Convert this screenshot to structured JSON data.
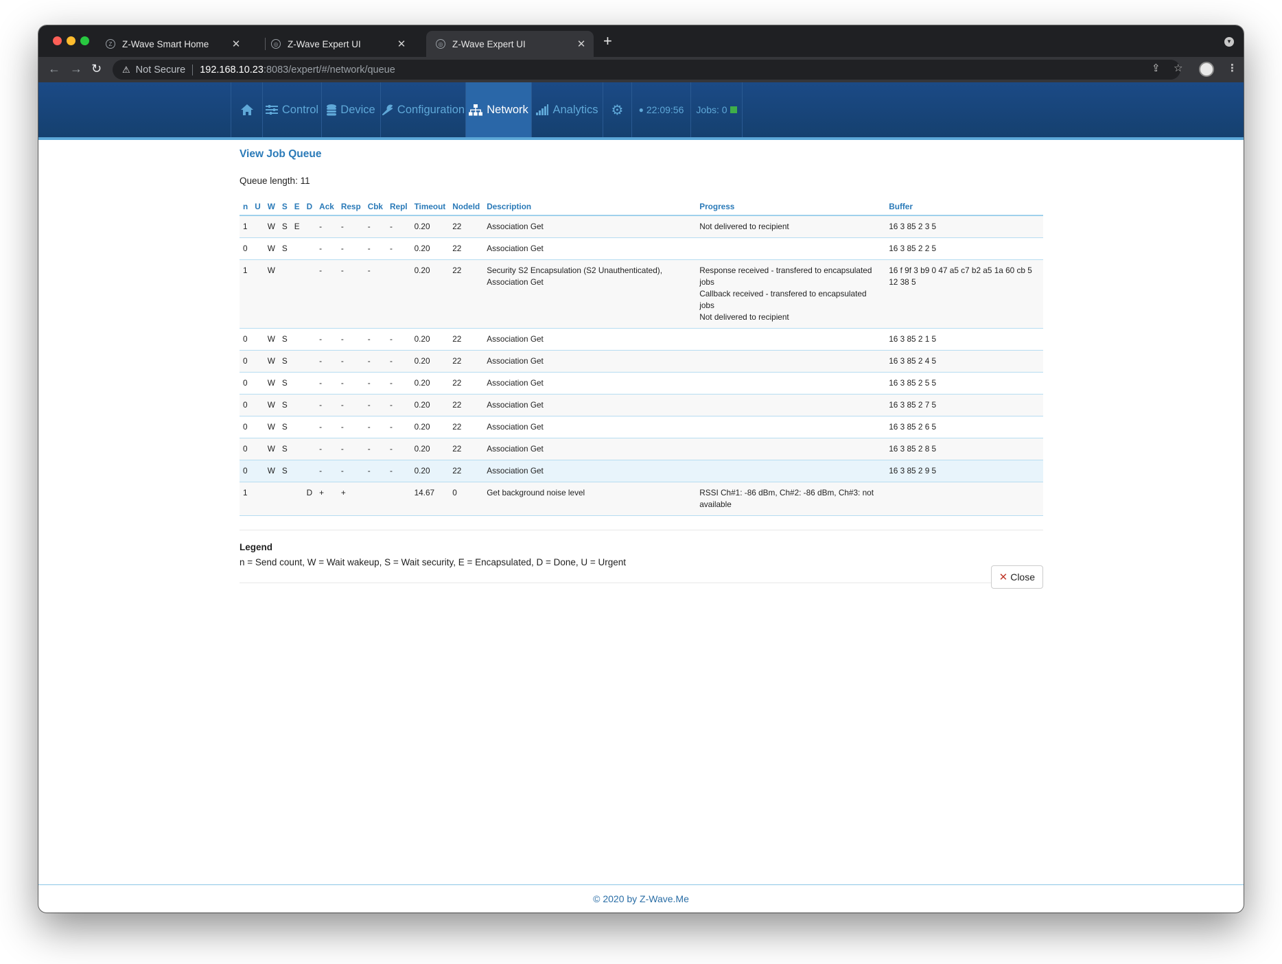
{
  "browser": {
    "tabs": [
      {
        "title": "Z-Wave Smart Home",
        "active": false
      },
      {
        "title": "Z-Wave Expert UI",
        "active": false
      },
      {
        "title": "Z-Wave Expert UI",
        "active": true
      }
    ],
    "new_tab": "+",
    "security_label": "Not Secure",
    "url_host": "192.168.10.23",
    "url_path": ":8083/expert/#/network/queue"
  },
  "nav": {
    "home_icon": "home-icon",
    "items": [
      {
        "label": "Control",
        "icon": "sliders-icon"
      },
      {
        "label": "Device",
        "icon": "database-icon"
      },
      {
        "label": "Configuration",
        "icon": "wrench-icon"
      },
      {
        "label": "Network",
        "icon": "sitemap-icon",
        "active": true
      },
      {
        "label": "Analytics",
        "icon": "signal-icon"
      }
    ],
    "settings_icon": "gear-icon",
    "time": "22:09:56",
    "jobs_label": "Jobs: 0",
    "jobs_status_color": "#3fae49"
  },
  "page": {
    "title": "View Job Queue",
    "queue_length": "Queue length: 11"
  },
  "table": {
    "columns": [
      "n",
      "U",
      "W",
      "S",
      "E",
      "D",
      "Ack",
      "Resp",
      "Cbk",
      "Repl",
      "Timeout",
      "NodeId",
      "Description",
      "Progress",
      "Buffer"
    ],
    "rows": [
      {
        "n": "1",
        "U": "",
        "W": "W",
        "S": "S",
        "E": "E",
        "D": "",
        "Ack": "-",
        "Resp": "-",
        "Cbk": "-",
        "Repl": "-",
        "Timeout": "0.20",
        "NodeId": "22",
        "Description": "Association Get",
        "Progress": [
          "Not delivered to recipient"
        ],
        "Buffer": "16 3 85 2 3 5"
      },
      {
        "n": "0",
        "U": "",
        "W": "W",
        "S": "S",
        "E": "",
        "D": "",
        "Ack": "-",
        "Resp": "-",
        "Cbk": "-",
        "Repl": "-",
        "Timeout": "0.20",
        "NodeId": "22",
        "Description": "Association Get",
        "Progress": [],
        "Buffer": "16 3 85 2 2 5"
      },
      {
        "n": "1",
        "U": "",
        "W": "W",
        "S": "",
        "E": "",
        "D": "",
        "Ack": "-",
        "Resp": "-",
        "Cbk": "-",
        "Repl": "",
        "Timeout": "0.20",
        "NodeId": "22",
        "Description": "Security S2 Encapsulation (S2 Unauthenticated), Association Get",
        "Progress": [
          "Response received - transfered to encapsulated jobs",
          "Callback received - transfered to encapsulated jobs",
          "Not delivered to recipient"
        ],
        "Buffer": "16 f 9f 3 b9 0 47 a5 c7 b2 a5 1a 60 cb 5 12 38 5"
      },
      {
        "n": "0",
        "U": "",
        "W": "W",
        "S": "S",
        "E": "",
        "D": "",
        "Ack": "-",
        "Resp": "-",
        "Cbk": "-",
        "Repl": "-",
        "Timeout": "0.20",
        "NodeId": "22",
        "Description": "Association Get",
        "Progress": [],
        "Buffer": "16 3 85 2 1 5"
      },
      {
        "n": "0",
        "U": "",
        "W": "W",
        "S": "S",
        "E": "",
        "D": "",
        "Ack": "-",
        "Resp": "-",
        "Cbk": "-",
        "Repl": "-",
        "Timeout": "0.20",
        "NodeId": "22",
        "Description": "Association Get",
        "Progress": [],
        "Buffer": "16 3 85 2 4 5"
      },
      {
        "n": "0",
        "U": "",
        "W": "W",
        "S": "S",
        "E": "",
        "D": "",
        "Ack": "-",
        "Resp": "-",
        "Cbk": "-",
        "Repl": "-",
        "Timeout": "0.20",
        "NodeId": "22",
        "Description": "Association Get",
        "Progress": [],
        "Buffer": "16 3 85 2 5 5"
      },
      {
        "n": "0",
        "U": "",
        "W": "W",
        "S": "S",
        "E": "",
        "D": "",
        "Ack": "-",
        "Resp": "-",
        "Cbk": "-",
        "Repl": "-",
        "Timeout": "0.20",
        "NodeId": "22",
        "Description": "Association Get",
        "Progress": [],
        "Buffer": "16 3 85 2 7 5"
      },
      {
        "n": "0",
        "U": "",
        "W": "W",
        "S": "S",
        "E": "",
        "D": "",
        "Ack": "-",
        "Resp": "-",
        "Cbk": "-",
        "Repl": "-",
        "Timeout": "0.20",
        "NodeId": "22",
        "Description": "Association Get",
        "Progress": [],
        "Buffer": "16 3 85 2 6 5"
      },
      {
        "n": "0",
        "U": "",
        "W": "W",
        "S": "S",
        "E": "",
        "D": "",
        "Ack": "-",
        "Resp": "-",
        "Cbk": "-",
        "Repl": "-",
        "Timeout": "0.20",
        "NodeId": "22",
        "Description": "Association Get",
        "Progress": [],
        "Buffer": "16 3 85 2 8 5"
      },
      {
        "n": "0",
        "U": "",
        "W": "W",
        "S": "S",
        "E": "",
        "D": "",
        "Ack": "-",
        "Resp": "-",
        "Cbk": "-",
        "Repl": "-",
        "Timeout": "0.20",
        "NodeId": "22",
        "Description": "Association Get",
        "Progress": [],
        "Buffer": "16 3 85 2 9 5",
        "highlight": true
      },
      {
        "n": "1",
        "U": "",
        "W": "",
        "S": "",
        "E": "",
        "D": "D",
        "Ack": "+",
        "Resp": "+",
        "Cbk": "",
        "Repl": "",
        "Timeout": "14.67",
        "NodeId": "0",
        "Description": "Get background noise level",
        "Progress": [
          "RSSI Ch#1: -86 dBm, Ch#2: -86 dBm, Ch#3: not available"
        ],
        "Buffer": ""
      }
    ]
  },
  "legend": {
    "title": "Legend",
    "text": "n = Send count, W = Wait wakeup, S = Wait security, E = Encapsulated, D = Done, U = Urgent"
  },
  "close_button": {
    "label": "Close",
    "icon": "close-x-icon"
  },
  "footer": {
    "text": "© 2020 by Z-Wave.Me"
  }
}
